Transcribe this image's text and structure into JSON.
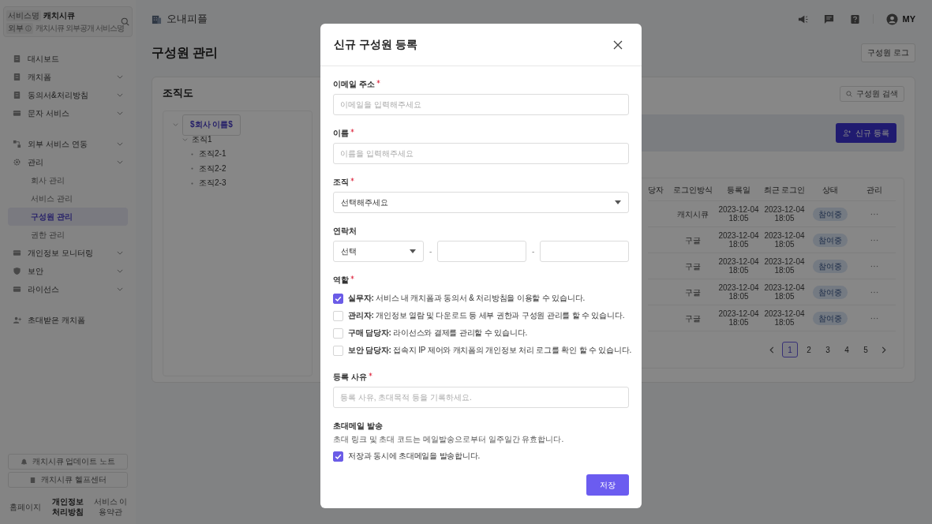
{
  "sidebar": {
    "service_badge": "서비스명",
    "service_name": "캐치시큐",
    "visibility_badge": "외부",
    "service_description": "캐치시큐 외부공개 서비스명",
    "groups": [
      {
        "items": [
          {
            "label": "대시보드",
            "expandable": false
          },
          {
            "label": "캐치폼",
            "expandable": true
          },
          {
            "label": "동의서&처리방침",
            "expandable": true
          },
          {
            "label": "문자 서비스",
            "expandable": true
          }
        ]
      },
      {
        "items": [
          {
            "label": "외부 서비스 연동",
            "expandable": true
          },
          {
            "label": "관리",
            "expandable": true,
            "children": [
              {
                "label": "회사 관리",
                "selected": false
              },
              {
                "label": "서비스 관리",
                "selected": false
              },
              {
                "label": "구성원 관리",
                "selected": true
              },
              {
                "label": "권한 관리",
                "selected": false
              }
            ]
          },
          {
            "label": "개인정보 모니터링",
            "expandable": true
          },
          {
            "label": "보안",
            "expandable": true
          },
          {
            "label": "라이선스",
            "expandable": true
          }
        ]
      },
      {
        "items": [
          {
            "label": "초대받은 캐치폼",
            "expandable": false
          }
        ]
      }
    ],
    "footer_buttons": [
      "캐치시큐 업데이트 노트",
      "캐치시큐 헬프센터"
    ],
    "footer_links": [
      {
        "label": "홈페이지",
        "bold": false
      },
      {
        "label": "개인정보 처리방침",
        "bold": true
      },
      {
        "label": "서비스 이용약관",
        "bold": false
      }
    ]
  },
  "header": {
    "workspace": "오내피플",
    "user": "MY"
  },
  "page": {
    "title": "구성원 관리",
    "log_button": "구성원 로그"
  },
  "org_chart": {
    "title": "조직도",
    "tree": [
      {
        "label": "$회사 이름$",
        "selected": true,
        "children": [
          {
            "label": "조직1",
            "selected": false,
            "children": [
              {
                "label": "조직2-1",
                "selected": false
              },
              {
                "label": "조직2-2",
                "selected": false
              },
              {
                "label": "조직2-3",
                "selected": false
              }
            ]
          }
        ]
      }
    ]
  },
  "members": {
    "search_button": "구성원 검색",
    "add_button": "신규 등록",
    "table": {
      "columns": [
        "당자",
        "로그인방식",
        "등록일",
        "최근 로그인",
        "상태",
        "관리"
      ],
      "rows": [
        {
          "login": "캐치시큐",
          "registered": "2023-12-04 18:05",
          "last_login": "2023-12-04 18:05",
          "status": "참여중"
        },
        {
          "login": "구글",
          "registered": "2023-12-04 18:05",
          "last_login": "2023-12-04 18:05",
          "status": "참여중"
        },
        {
          "login": "구글",
          "registered": "2023-12-04 18:05",
          "last_login": "2023-12-04 18:05",
          "status": "참여중"
        },
        {
          "login": "구글",
          "registered": "2023-12-04 18:05",
          "last_login": "2023-12-04 18:05",
          "status": "참여중"
        },
        {
          "login": "구글",
          "registered": "2023-12-04 18:05",
          "last_login": "2023-12-04 18:05",
          "status": "참여중"
        }
      ]
    },
    "pages": [
      {
        "label": "1",
        "selected": true
      },
      {
        "label": "2",
        "selected": false
      },
      {
        "label": "3",
        "selected": false
      },
      {
        "label": "4",
        "selected": false
      },
      {
        "label": "5",
        "selected": false
      }
    ]
  },
  "modal": {
    "title": "신규 구성원 등록",
    "fields": [
      {
        "kind": "text",
        "label": "이메일 주소",
        "required": true,
        "placeholder": "이메일을 입력해주세요"
      },
      {
        "kind": "text",
        "label": "이름",
        "required": true,
        "placeholder": "이름을 입력해주세요"
      },
      {
        "kind": "select",
        "label": "조직",
        "required": true,
        "value": "선택해주세요"
      },
      {
        "kind": "phone",
        "label": "연락처",
        "required": false,
        "value": "선택",
        "separator": "-"
      }
    ],
    "roles": {
      "label": "역할",
      "required": true,
      "options": [
        {
          "text": "**실무자:** 서비스 내 캐치폼과 동의서 & 처리방침을 이용할 수 있습니다.",
          "checked": true
        },
        {
          "text": "**관리자:** 개인정보 열람 및 다운로드 등 세부 권한과 구성원 관리를 할 수 있습니다.",
          "checked": false
        },
        {
          "text": "**구매 담당자:** 라이선스와 결제를 관리할 수 있습니다.",
          "checked": false
        },
        {
          "text": "**보안 담당자:** 접속지 IP 제어와 캐치폼의 개인정보 처리 로그를 확인 할 수 있습니다.",
          "checked": false
        }
      ]
    },
    "reason": {
      "label": "등록 사유",
      "required": true,
      "placeholder": "등록 사유, 초대목적 등을 기록하세요."
    },
    "invite": {
      "title": "초대메일 발송",
      "note": "초대 링크 및 초대 코드는 메일발송으로부터 일주일간 유효합니다.",
      "option": {
        "label": "저장과 동시에 초대메일을 발송합니다.",
        "checked": true
      }
    },
    "save_button": "저장"
  }
}
